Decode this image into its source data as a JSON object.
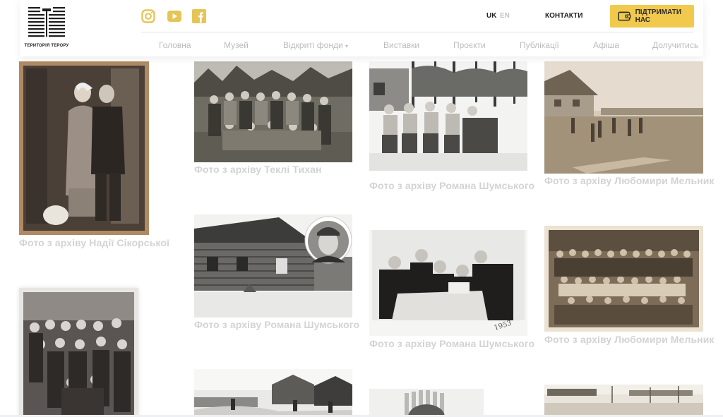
{
  "header": {
    "logo": {
      "text": "ТЕРИТОРІЯ ТЕРОРУ",
      "icon": "territory-of-terror-logo"
    },
    "social": [
      {
        "name": "instagram",
        "icon": "instagram-icon"
      },
      {
        "name": "youtube",
        "icon": "youtube-icon"
      },
      {
        "name": "facebook",
        "icon": "facebook-icon"
      }
    ],
    "languages": [
      {
        "code": "UK",
        "active": true
      },
      {
        "code": "EN",
        "active": false
      }
    ],
    "contacts_label": "КОНТАКТИ",
    "support_label": "ПІДТРИМАТИ НАС",
    "support_icon": "wallet-icon",
    "accent_color": "#f1c94d",
    "nav": [
      {
        "label": "Головна"
      },
      {
        "label": "Музей"
      },
      {
        "label": "Відкриті фонди",
        "dropdown_icon": "▾"
      },
      {
        "label": "Виставки"
      },
      {
        "label": "Проєкти"
      },
      {
        "label": "Публікації"
      },
      {
        "label": "Афіша"
      },
      {
        "label": "Долучитись"
      }
    ]
  },
  "gallery": {
    "caption_color": "#d3d3d3",
    "items": [
      {
        "caption": "Фото з архіву Надії Сікорської",
        "photo": "wedding-portrait-photo"
      },
      {
        "caption": "",
        "photo": "group-of-women-photo"
      },
      {
        "caption": "Фото з архіву Теклі Тихан",
        "photo": "group-in-forest-photo"
      },
      {
        "caption": "Фото з архіву Романа Шумського",
        "photo": "log-barracks-photo"
      },
      {
        "caption": "",
        "photo": "snowy-village-photo"
      },
      {
        "caption": "Фото з архіву Романа Шумського",
        "photo": "men-sitting-photo"
      },
      {
        "caption": "Фото з архіву Романа Шумського",
        "photo": "men-reading-photo"
      },
      {
        "caption": "",
        "photo": "blurred-portrait-photo"
      },
      {
        "caption": "Фото з архіву Любомири Мельник",
        "photo": "village-house-photo"
      },
      {
        "caption": "Фото з архіву Любомири Мельник",
        "photo": "large-group-photo"
      },
      {
        "caption": "",
        "photo": "settlement-photo"
      }
    ]
  }
}
